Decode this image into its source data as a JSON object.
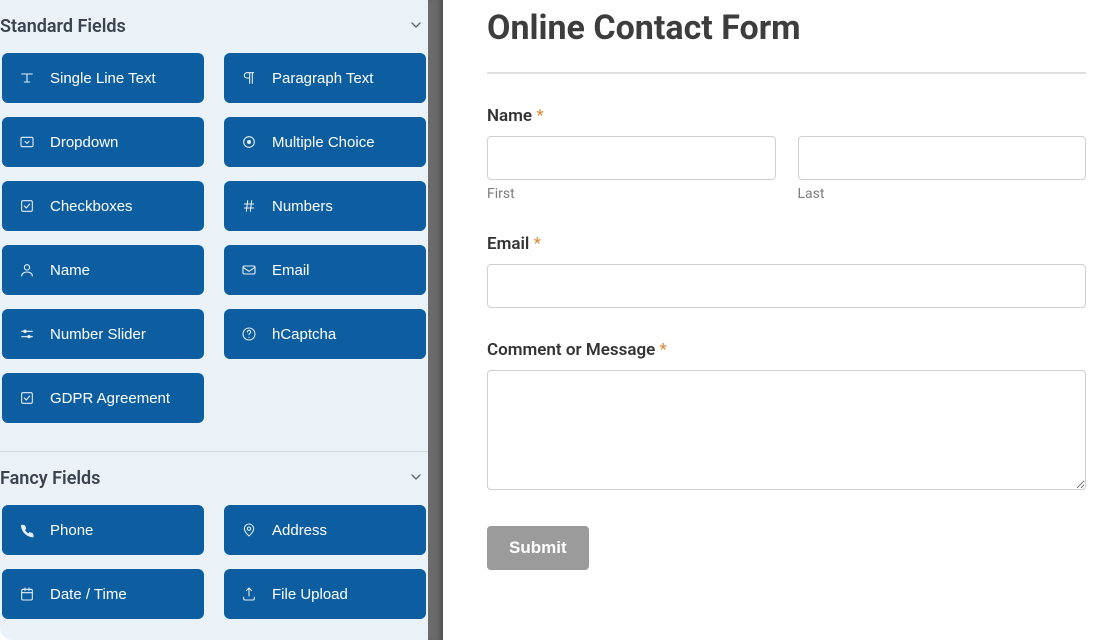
{
  "sidebar": {
    "sections": [
      {
        "title": "Standard Fields",
        "fields": [
          {
            "icon": "text",
            "label": "Single Line Text"
          },
          {
            "icon": "paragraph",
            "label": "Paragraph Text"
          },
          {
            "icon": "dropdown",
            "label": "Dropdown"
          },
          {
            "icon": "radio",
            "label": "Multiple Choice"
          },
          {
            "icon": "checkbox",
            "label": "Checkboxes"
          },
          {
            "icon": "hash",
            "label": "Numbers"
          },
          {
            "icon": "user",
            "label": "Name"
          },
          {
            "icon": "mail",
            "label": "Email"
          },
          {
            "icon": "slider",
            "label": "Number Slider"
          },
          {
            "icon": "question",
            "label": "hCaptcha"
          },
          {
            "icon": "checkbox",
            "label": "GDPR Agreement"
          }
        ]
      },
      {
        "title": "Fancy Fields",
        "fields": [
          {
            "icon": "phone",
            "label": "Phone"
          },
          {
            "icon": "pin",
            "label": "Address"
          },
          {
            "icon": "calendar",
            "label": "Date / Time"
          },
          {
            "icon": "upload",
            "label": "File Upload"
          }
        ]
      }
    ]
  },
  "form": {
    "title": "Online Contact Form",
    "name_label": "Name",
    "first_sublabel": "First",
    "last_sublabel": "Last",
    "email_label": "Email",
    "message_label": "Comment or Message",
    "submit_label": "Submit",
    "required_marker": "*"
  }
}
